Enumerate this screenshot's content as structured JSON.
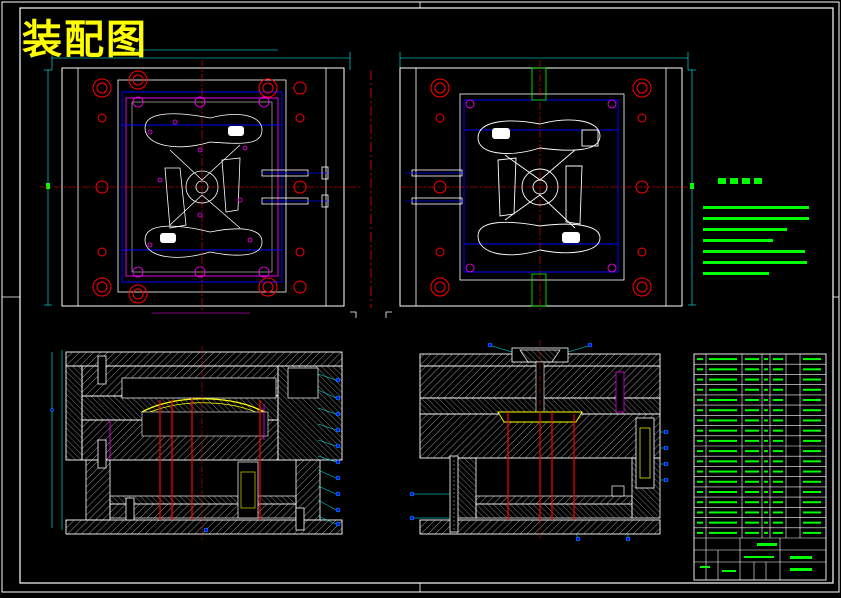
{
  "drawing": {
    "title": "装配图"
  },
  "colors": {
    "background": "#000000",
    "title": "#ffff00",
    "frame": "#ffffff",
    "dimension": "#00ffff",
    "centerline": "#ff0000",
    "part": "#ff00ff",
    "cooling": "#0000ff",
    "text": "#00ff00",
    "hatch": "#ffffff"
  }
}
